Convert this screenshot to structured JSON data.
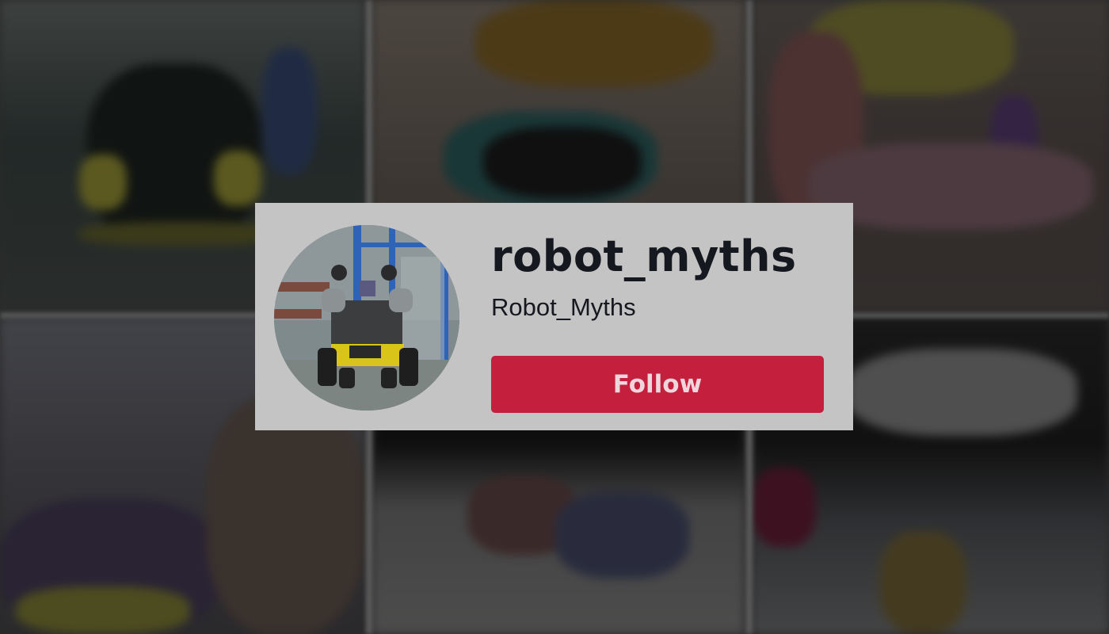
{
  "profile": {
    "username": "robot_myths",
    "nickname": "Robot_Myths",
    "avatar_icon": "robot-vehicle-avatar"
  },
  "actions": {
    "follow_label": "Follow"
  },
  "colors": {
    "card_background": "#c4c4c4",
    "follow_button": "#c41f3c",
    "text_primary": "#16181f"
  },
  "background": {
    "description_icon": "blurred-video-grid"
  }
}
